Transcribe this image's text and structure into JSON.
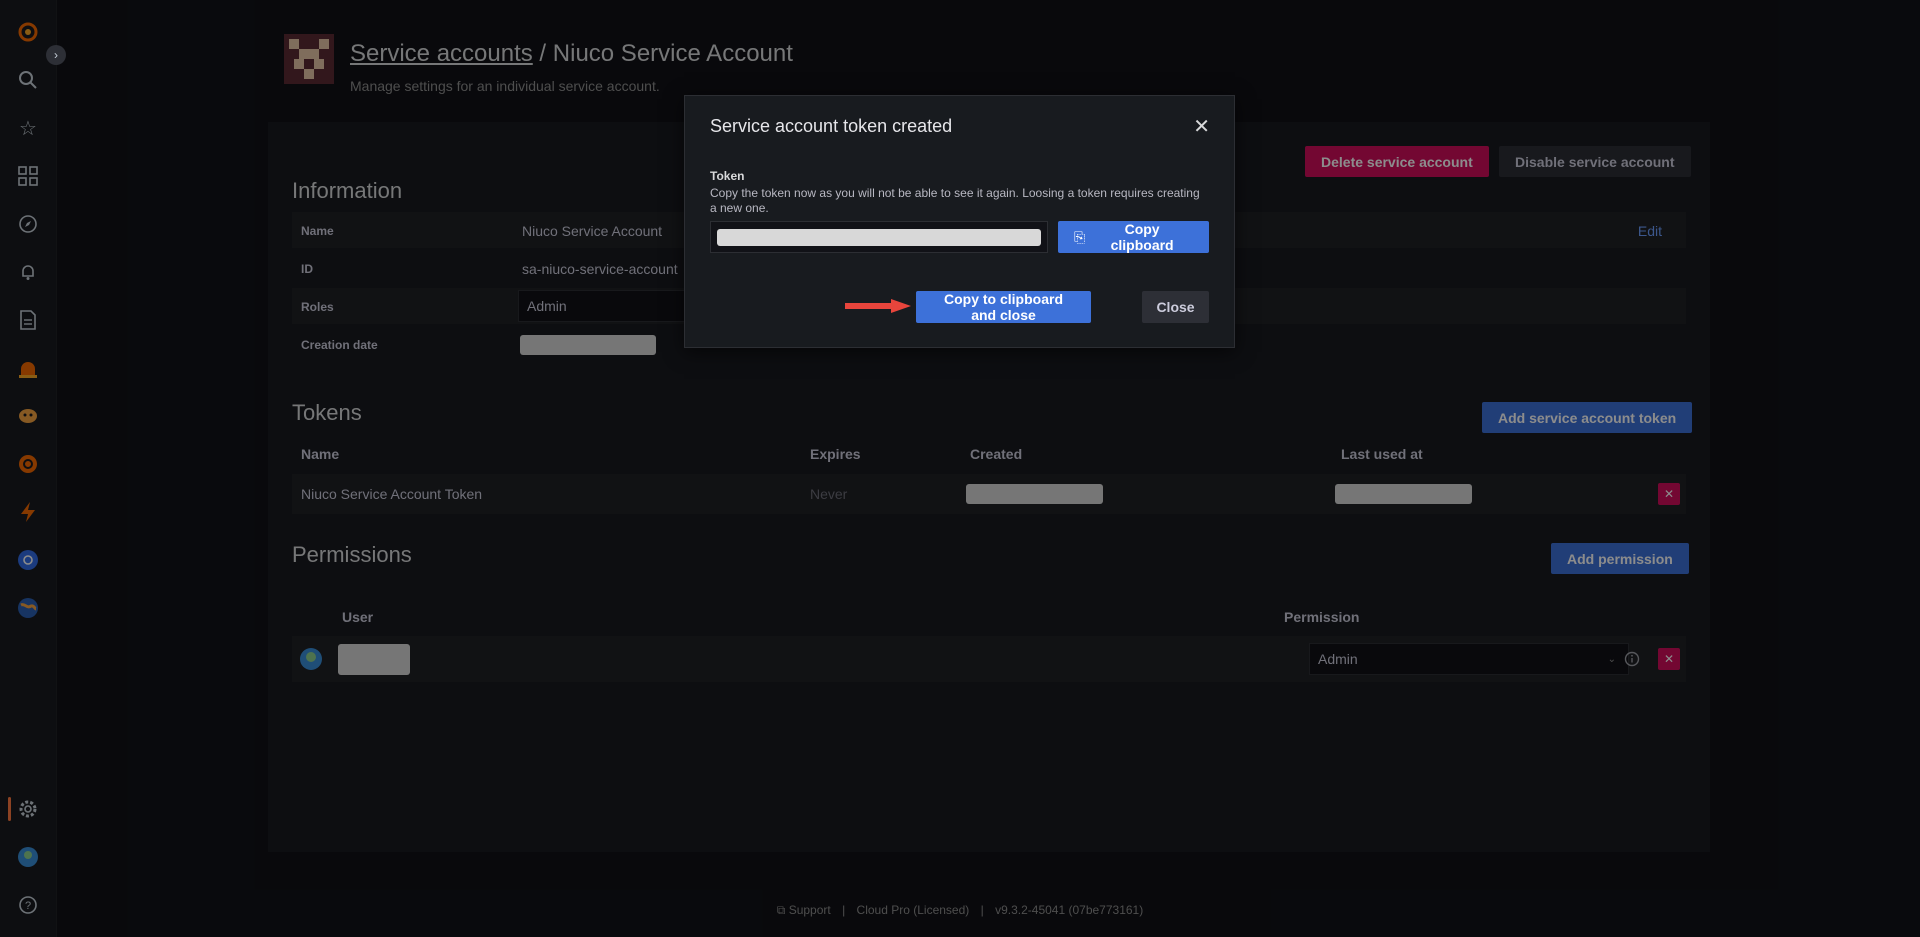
{
  "sidebar": {
    "items": [
      "grafana-logo-icon",
      "search-icon",
      "star-icon",
      "dashboards-icon",
      "explore-icon",
      "bell-icon",
      "reports-icon",
      "alerting-icon",
      "ml-icon",
      "oncall-icon",
      "k6-icon",
      "kubernetes-icon",
      "globe-icon",
      "gear-icon",
      "user-avatar-icon",
      "help-icon"
    ],
    "toggle": "›"
  },
  "header": {
    "breadcrumb": "Service accounts",
    "separator": " / ",
    "title": "Niuco Service Account",
    "subtitle": "Manage settings for an individual service account."
  },
  "actions": {
    "delete": "Delete service account",
    "disable": "Disable service account"
  },
  "information": {
    "title": "Information",
    "edit": "Edit",
    "name_label": "Name",
    "name_value": "Niuco Service Account",
    "id_label": "ID",
    "id_value": "sa-niuco-service-account",
    "roles_label": "Roles",
    "roles_value": "Admin",
    "creation_label": "Creation date"
  },
  "tokens": {
    "title": "Tokens",
    "add": "Add service account token",
    "columns": [
      "Name",
      "Expires",
      "Created",
      "Last used at"
    ],
    "rows": [
      {
        "name": "Niuco Service Account Token",
        "expires": "Never"
      }
    ]
  },
  "permissions": {
    "title": "Permissions",
    "add": "Add permission",
    "col_user": "User",
    "col_permission": "Permission",
    "permission_value": "Admin"
  },
  "footer": {
    "support": "Support",
    "license": "Cloud Pro (Licensed)",
    "version": "v9.3.2-45041 (07be773161)"
  },
  "modal": {
    "title": "Service account token created",
    "label": "Token",
    "description": "Copy the token now as you will not be able to see it again. Loosing a token requires creating a new one.",
    "copy": "Copy clipboard",
    "copy_close": "Copy to clipboard and close",
    "close": "Close"
  },
  "colors": {
    "accent": "#3d71d9",
    "danger": "#d10e5c",
    "arrow": "#e8453c"
  }
}
